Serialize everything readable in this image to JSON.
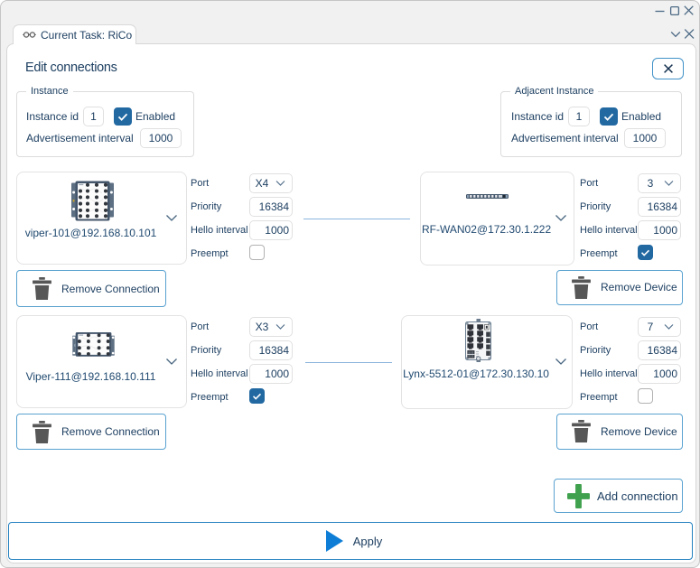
{
  "window": {
    "controls": [
      "minimize",
      "maximize",
      "close"
    ]
  },
  "tab": {
    "label": "Current Task: RiCo",
    "strip_controls": [
      "tab-list-chevron",
      "close-tab"
    ]
  },
  "dialog": {
    "title": "Edit connections"
  },
  "groups": {
    "instance": {
      "legend": "Instance",
      "instance_id_label": "Instance id",
      "instance_id_value": "1",
      "enabled_label": "Enabled",
      "enabled_checked": true,
      "adv_interval_label": "Advertisement interval",
      "adv_interval_value": "1000"
    },
    "adjacent": {
      "legend": "Adjacent Instance",
      "instance_id_label": "Instance id",
      "instance_id_value": "1",
      "enabled_label": "Enabled",
      "enabled_checked": true,
      "adv_interval_label": "Advertisement interval",
      "adv_interval_value": "1000"
    }
  },
  "form_labels": {
    "port": "Port",
    "priority": "Priority",
    "hello": "Hello interval",
    "preempt": "Preempt"
  },
  "connections": [
    {
      "left": {
        "device_label": "viper-101@192.168.10.101",
        "device_icon": "rugged-switch-top",
        "port": "X4",
        "priority": "16384",
        "hello": "1000",
        "preempt": false
      },
      "right": {
        "device_label": "RF-WAN02@172.30.1.222",
        "device_icon": "rack-router-front",
        "port": "3",
        "priority": "16384",
        "hello": "1000",
        "preempt": true
      },
      "remove_connection_label": "Remove Connection",
      "remove_device_label": "Remove Device"
    },
    {
      "left": {
        "device_label": "Viper-111@192.168.10.111",
        "device_icon": "rugged-switch-top-small",
        "port": "X3",
        "priority": "16384",
        "hello": "1000",
        "preempt": true
      },
      "right": {
        "device_label": "Lynx-5512-01@172.30.130.10",
        "device_icon": "din-rail-switch-front",
        "port": "7",
        "priority": "16384",
        "hello": "1000",
        "preempt": false
      },
      "remove_connection_label": "Remove Connection",
      "remove_device_label": "Remove Device"
    }
  ],
  "buttons": {
    "add_connection": "Add connection",
    "apply": "Apply"
  },
  "colors": {
    "accent_blue": "#2381c0",
    "checkbox_blue": "#2269a2",
    "button_border_blue": "#5aa2d0",
    "green_plus": "#3fa14d",
    "play_triangle": "#0d7dd6",
    "text_navy": "#1d3f61",
    "connector_blue": "#8cb5de",
    "chrome_gray": "#f0f0f0",
    "trash_gray": "#575757"
  }
}
